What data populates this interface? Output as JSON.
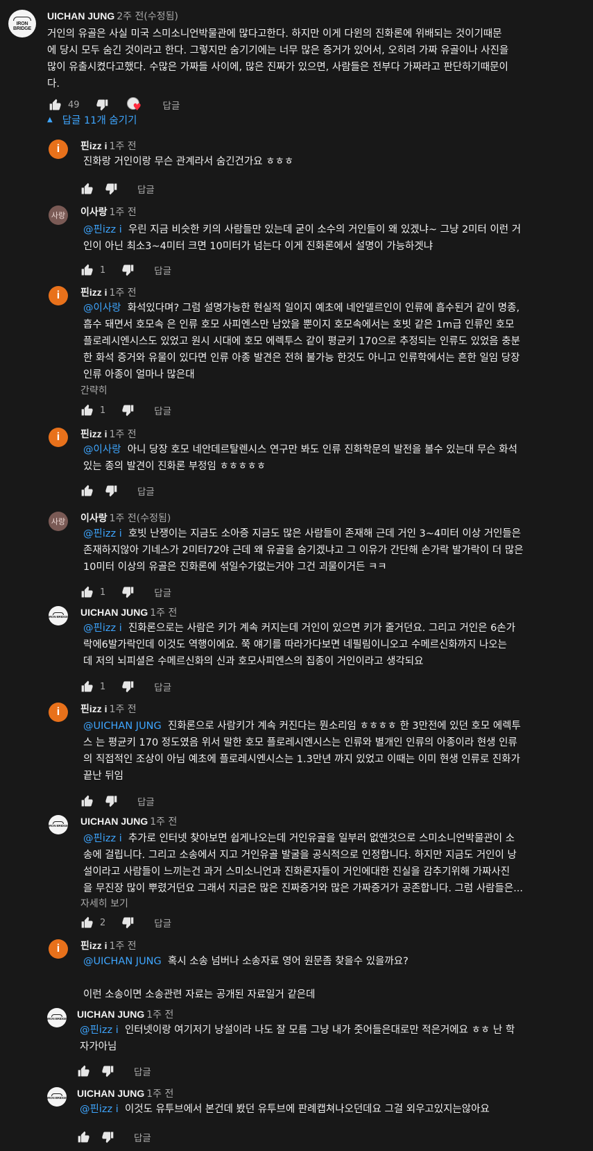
{
  "labels": {
    "reply": "답글",
    "hide_replies": "답글 11개 숨기기",
    "show_less": "간략히",
    "read_more": "자세히 보기"
  },
  "avatars": {
    "bridge_line1": "IRON",
    "bridge_line2": "BRIDGE",
    "i_letter": "i",
    "sa_text": "사랑"
  },
  "main": {
    "author": "UICHAN JUNG",
    "time": "2주 전(수정됨)",
    "lines": [
      "거인의 유골은 사실 미국 스미소니언박물관에 많다고한다. 하지만 이게 다윈의 진화론에 위배되는 것이기때문",
      "에 당시 모두 숨긴 것이라고 한다. 그렇지만 숨기기에는 너무 많은 증거가 있어서, 오히려 가짜 유골이나 사진을",
      "많이 유출시켰다고했다. 수많은 가짜들 사이에, 많은 진짜가 있으면, 사람들은 전부다 가짜라고 판단하기때문이",
      "다."
    ],
    "likes": "49"
  },
  "replies": [
    {
      "author": "핀izz i",
      "time": "1주 전",
      "mention": "",
      "lines": [
        "진화랑 거인이랑 무슨 관계라서 숨긴건가요 ㅎㅎㅎ"
      ],
      "likes": ""
    },
    {
      "author": "이사랑",
      "time": "1주 전",
      "mention": "@핀izz i",
      "lines": [
        "우린 지금 비슷한 키의 사람들만 있는데 굳이 소수의 거인들이 왜 있겠냐~ 그냥 2미터 이런 거",
        "인이 아닌 최소3~4미터 크면 10미터가 넘는다 이게 진화론에서 설명이 가능하겟냐"
      ],
      "likes": "1"
    },
    {
      "author": "핀izz i",
      "time": "1주 전",
      "mention": "@이사랑",
      "lines": [
        "화석있다며? 그럼 설명가능한 현실적 일이지 예초에 네안델르인이 인류에 흡수된거 같이 명종,",
        "흡수 돼면서 호모속 은 인류 호모 사피엔스만 남았을 뿐이지 호모속에서는 호빗 같은 1m급 인류인 호모",
        "플로레시엔시스도 있었고 원시 시대에 호모 에렉투스 같이 평균키 170으로 추정되는 인류도 있었음 충분",
        "한 화석 증거와 유물이 있다면 인류 아종 발견은 전혀 불가능 한것도 아니고 인류학에서는 흔한 일임 당장",
        "인류 아종이 얼마나 많은대"
      ],
      "likes": "1"
    },
    {
      "author": "핀izz i",
      "time": "1주 전",
      "mention": "@이사랑",
      "lines": [
        "아니 당장 호모 네안데르탈렌시스 연구만 봐도 인류 진화학문의 발전을 볼수 있는대 무슨 화석",
        "있는 종의 발견이 진화론 부정임 ㅎㅎㅎㅎㅎ"
      ],
      "likes": ""
    },
    {
      "author": "이사랑",
      "time": "1주 전(수정됨)",
      "mention": "@핀izz i",
      "lines": [
        "호빗 난쟁이는 지금도 소아증 지금도 많은 사람들이 존재해 근데 거인 3~4미터 이상 거인들은",
        "존재하지않아 기네스가 2미터72야 근데 왜 유골을 숨기겠냐고 그 이유가 간단해 손가락 발가락이 더 많은",
        "10미터 이상의 유골은 진화론에 섞일수가없는거야 그건 괴물이거든 ㅋㅋ"
      ],
      "likes": "1"
    },
    {
      "author": "UICHAN JUNG",
      "time": "1주 전",
      "mention": "@핀izz i",
      "lines": [
        "진화론으로는 사람은 키가 계속 커지는데 거인이 있으면 키가 줄거던요. 그리고 거인은 6손가",
        "락에6발가락인데 이것도 역행이에요.  쭉 얘기를 따라가다보면 네필림이니오고 수메르신화까지 나오는",
        "데 저의 뇌피셜은 수메르신화의 신과 호모사피엔스의 집종이 거인이라고 생각되요"
      ],
      "likes": "1"
    },
    {
      "author": "핀izz i",
      "time": "1주 전",
      "mention": "@UICHAN JUNG",
      "lines": [
        "진화론으로 사람키가 계속 커진다는 뭔소리임 ㅎㅎㅎㅎ 한 3만전에 있던 호모 에렉투",
        "스 는 평균키 170 정도였음 위서 말한 호모 플로레시엔시스는 인류와 별개인 인류의 아종이라 현생 인류",
        "의 직접적인 조상이 아님 예초에 플로레시엔시스는 1.3만년 까지 있었고 이때는 이미 현생 인류로 진화가",
        "끝난 뒤임"
      ],
      "likes": ""
    },
    {
      "author": "UICHAN JUNG",
      "time": "1주 전",
      "mention": "@핀izz i",
      "lines": [
        "추가로 인터넷 찾아보면 쉽게나오는데 거인유골을 일부러 없앤것으로 스미소니언박물관이 소",
        "송에 걸립니다. 그리고 소송에서 지고 거인유골 발굴을 공식적으로 인정합니다. 하지만 지금도 거인이 낭",
        "설이라고 사람들이 느끼는건 과거 스미소니언과 진화론자들이 거인에대한 진실을 감추기위해 가짜사진",
        "을 무진장 많이 뿌렸거던요 그래서 지금은 많은 진짜증거와 많은 가짜증거가 공존합니다. 그럼 사람들은..."
      ],
      "likes": "2"
    },
    {
      "author": "핀izz i",
      "time": "1주 전",
      "mention": "@UICHAN JUNG",
      "lines": [
        "혹시 소송 넘버나 소송자료 영어 원문좀 찾을수 있을까요?",
        "",
        "이런 소송이면 소송관련 자료는 공개된 자료일거 같은데"
      ],
      "likes": ""
    },
    {
      "author": "UICHAN JUNG",
      "time": "1주 전",
      "mention": "@핀izz i",
      "lines": [
        "인터넷이랑 여기저기 낭설이라 나도 잘 모름 그냥 내가 줏어들은대로만 적은거에요 ㅎㅎ 난 학",
        "자가아님"
      ],
      "likes": ""
    },
    {
      "author": "UICHAN JUNG",
      "time": "1주 전",
      "mention": "@핀izz i",
      "lines": [
        "이것도 유투브에서 본건데 봤던 유투브에 판례캡쳐나오던데요 그걸 외우고있지는않아요"
      ],
      "likes": ""
    }
  ]
}
